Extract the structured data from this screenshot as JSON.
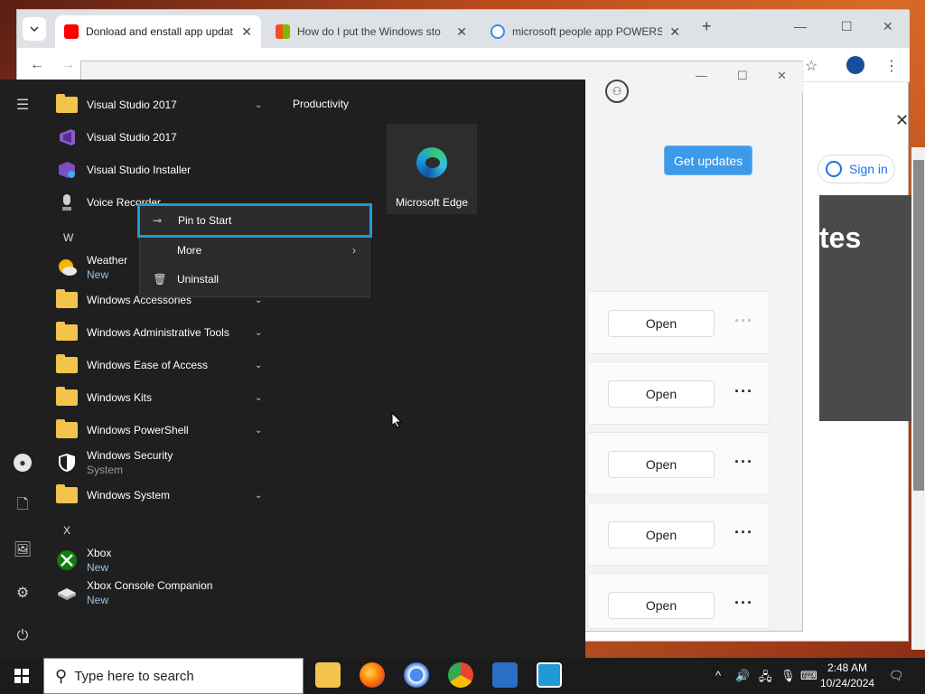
{
  "browser": {
    "tabs": [
      {
        "title": "Donload and enstall app updat",
        "active": true
      },
      {
        "title": "How do I put the Windows sto",
        "active": false
      },
      {
        "title": "microsoft people app POWERS",
        "active": false
      }
    ],
    "new_tab": "+",
    "page": {
      "sign_in": "Sign in",
      "heading_fragment": "tes"
    }
  },
  "store": {
    "get_updates": "Get updates",
    "rows": [
      {
        "open_label": "Open",
        "more": "···"
      },
      {
        "open_label": "Open",
        "more": "···"
      },
      {
        "open_label": "Open",
        "more": "···"
      },
      {
        "open_label": "Open",
        "more": "···"
      },
      {
        "open_label": "Open",
        "more": "···"
      }
    ]
  },
  "start_menu": {
    "group_title": "Productivity",
    "tile": {
      "label": "Microsoft Edge"
    },
    "items": [
      {
        "label": "Visual Studio 2017",
        "type": "folder",
        "expand": true
      },
      {
        "label": "Visual Studio 2017",
        "type": "vs"
      },
      {
        "label": "Visual Studio Installer",
        "type": "vsi"
      },
      {
        "label": "Voice Recorder",
        "type": "mic"
      },
      {
        "letter": "W"
      },
      {
        "label": "Weather",
        "sub": "New",
        "type": "weather"
      },
      {
        "label": "Windows Accessories",
        "type": "folder",
        "expand": true
      },
      {
        "label": "Windows Administrative Tools",
        "type": "folder",
        "expand": true
      },
      {
        "label": "Windows Ease of Access",
        "type": "folder",
        "expand": true
      },
      {
        "label": "Windows Kits",
        "type": "folder",
        "expand": true
      },
      {
        "label": "Windows PowerShell",
        "type": "folder",
        "expand": true
      },
      {
        "label": "Windows Security",
        "sub": "System",
        "type": "shield"
      },
      {
        "label": "Windows System",
        "type": "folder",
        "expand": true
      },
      {
        "letter": "X"
      },
      {
        "label": "Xbox",
        "sub": "New",
        "type": "xbox"
      },
      {
        "label": "Xbox Console Companion",
        "sub": "New",
        "type": "console"
      }
    ],
    "context_menu": {
      "pin": "Pin to Start",
      "more": "More",
      "uninstall": "Uninstall"
    }
  },
  "taskbar": {
    "search_placeholder": "Type here to search",
    "time": "2:48 AM",
    "date": "10/24/2024"
  },
  "colors": {
    "accent": "#1e9ad6",
    "store_button": "#3c9ae8",
    "start_bg": "#1f1f1f",
    "folder": "#f3c44c"
  }
}
